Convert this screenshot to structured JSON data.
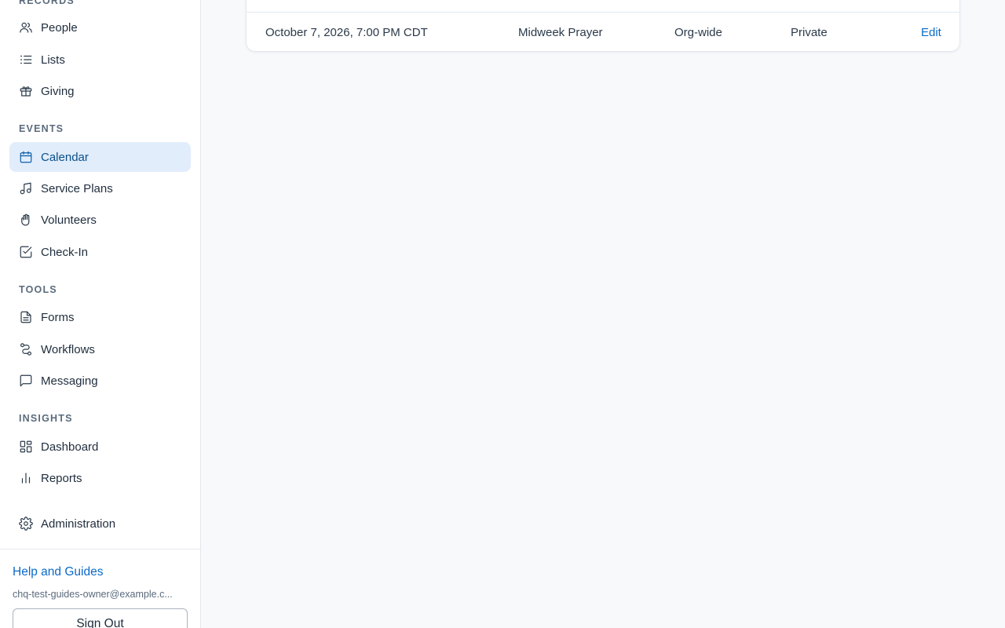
{
  "sidebar": {
    "sections": {
      "records": "RECORDS",
      "events": "EVENTS",
      "tools": "TOOLS",
      "insights": "INSIGHTS"
    },
    "items": {
      "people": "People",
      "lists": "Lists",
      "giving": "Giving",
      "calendar": "Calendar",
      "service_plans": "Service Plans",
      "volunteers": "Volunteers",
      "check_in": "Check-In",
      "forms": "Forms",
      "workflows": "Workflows",
      "messaging": "Messaging",
      "dashboard": "Dashboard",
      "reports": "Reports",
      "administration": "Administration"
    },
    "active_item": "calendar",
    "footer": {
      "help_label": "Help and Guides",
      "user_email": "chq-test-guides-owner@example.c...",
      "sign_out_label": "Sign Out"
    }
  },
  "events_table": {
    "rows": [
      {
        "date": "October 7, 2026, 7:00 PM CDT",
        "name": "Midweek Prayer",
        "scope": "Org-wide",
        "visibility": "Private",
        "action": "Edit"
      }
    ]
  },
  "colors": {
    "accent": "#0b6ac7",
    "active_bg": "#e1edfb",
    "page_bg": "#f7f9fb"
  }
}
